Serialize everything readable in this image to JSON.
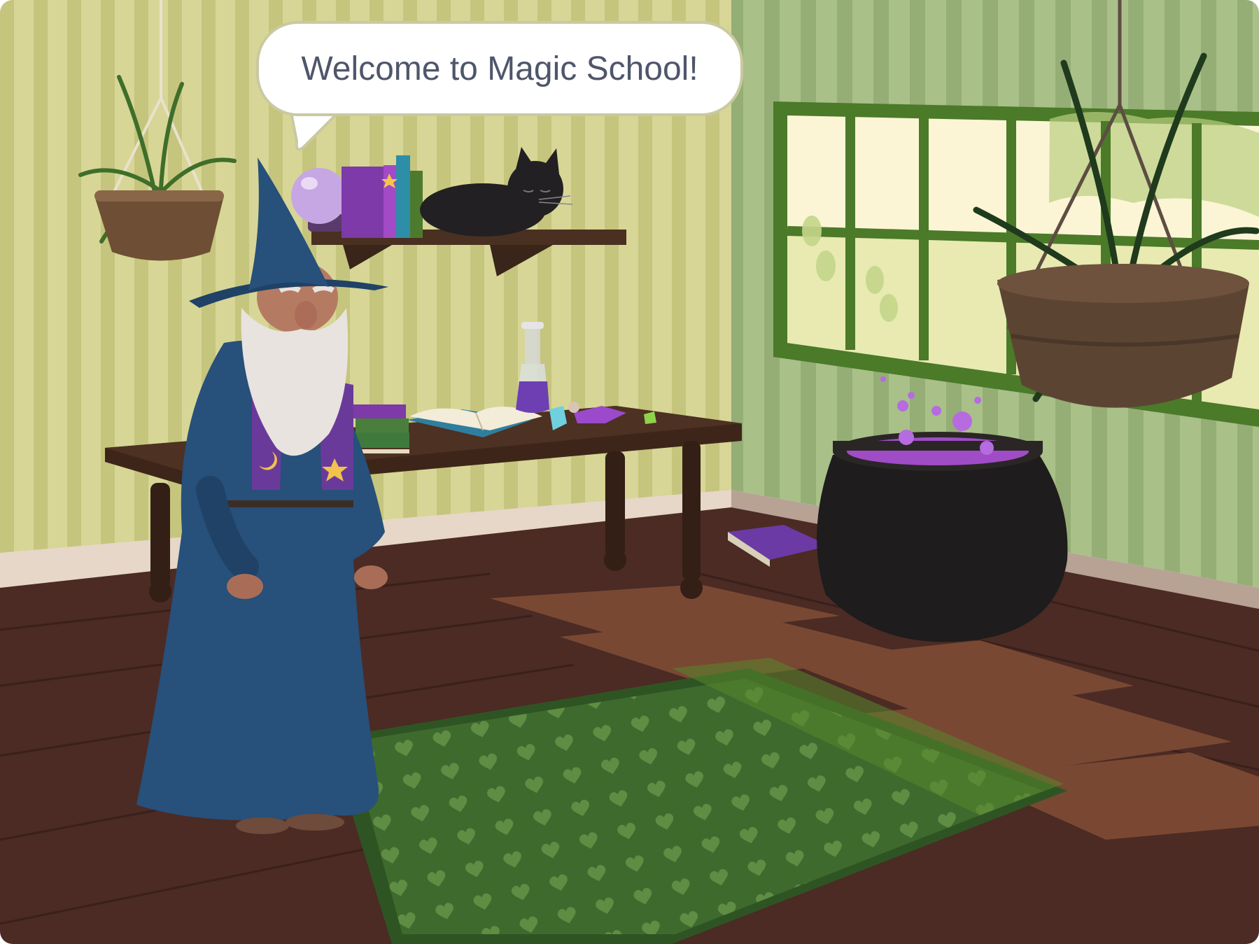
{
  "speech_bubble": {
    "text": "Welcome to Magic School!"
  },
  "scene_colors": {
    "wall_stripe_light": "#d3d28f",
    "wall_stripe_dark": "#c2c27a",
    "right_wall_light": "#a6bd84",
    "right_wall_dark": "#93ad74",
    "floor": "#4a2b24",
    "rug": "#3f6a2e",
    "potion": "#a052c8",
    "robe": "#27507a"
  }
}
